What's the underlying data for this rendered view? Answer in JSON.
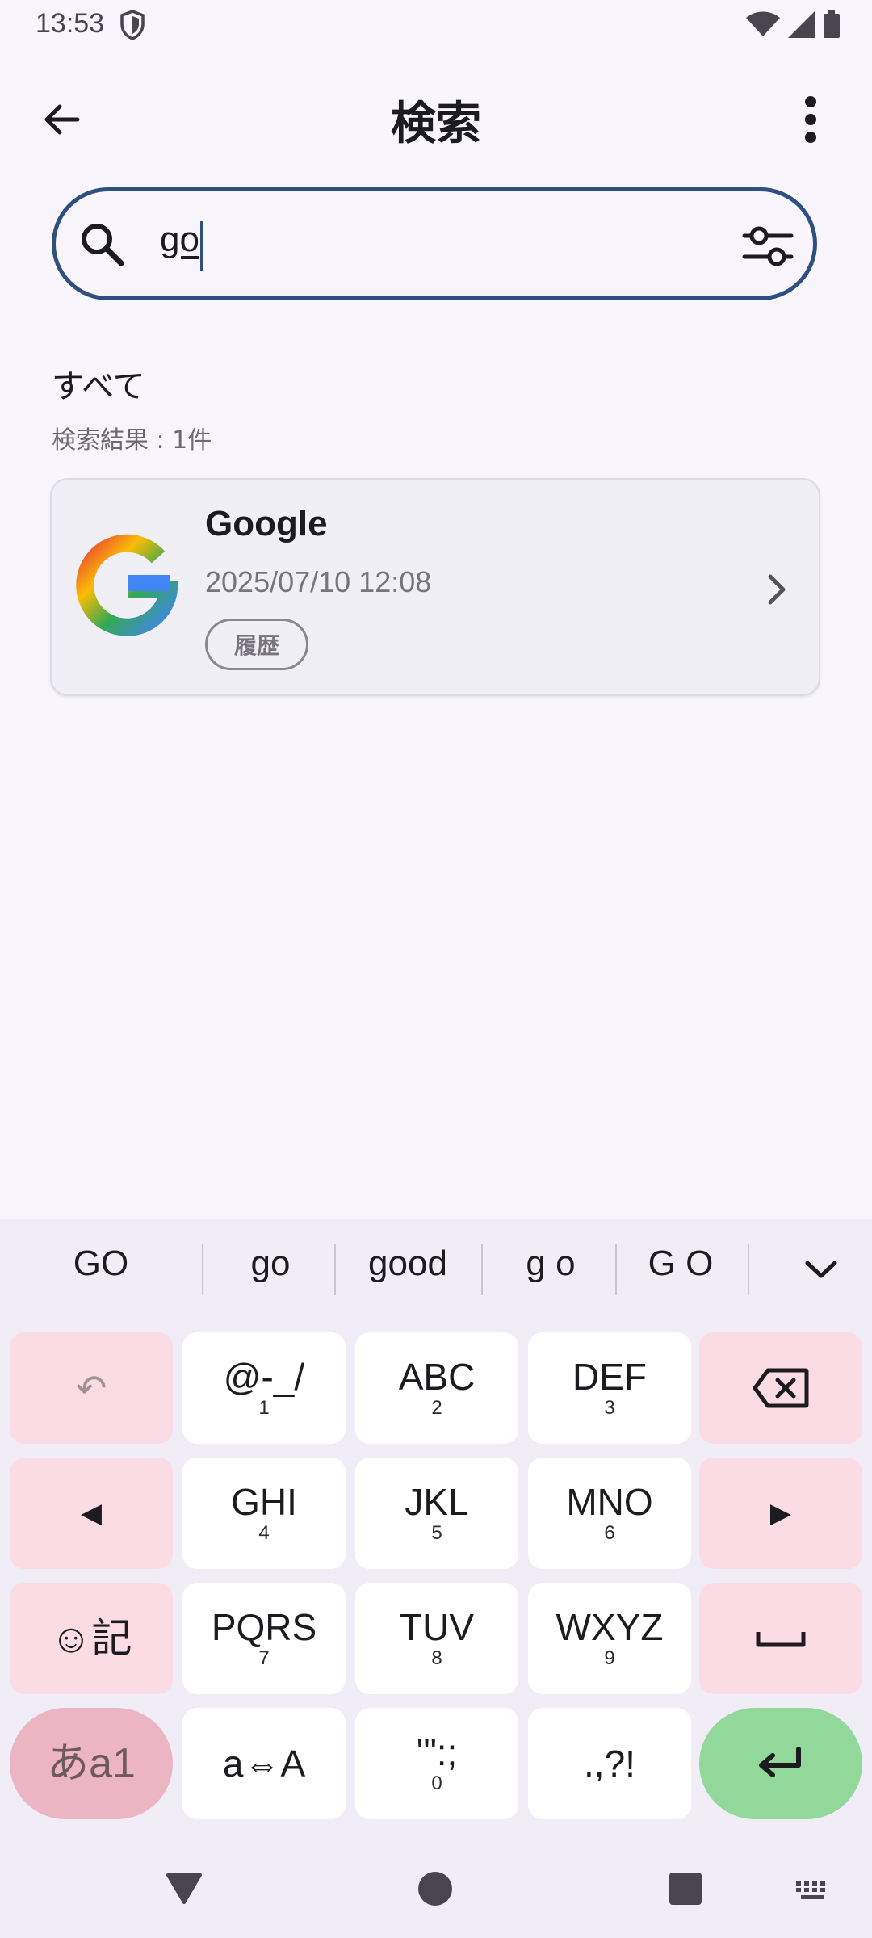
{
  "status_bar": {
    "time": "13:53"
  },
  "app_bar": {
    "title": "検索"
  },
  "search": {
    "value": "go"
  },
  "section": {
    "title": "すべて",
    "result_count": "検索結果 : 1件"
  },
  "results": [
    {
      "title": "Google",
      "datetime": "2025/07/10 12:08",
      "tag": "履歴"
    }
  ],
  "keyboard": {
    "suggestions": [
      "GO",
      "go",
      "good",
      "g o",
      "G O"
    ],
    "rows": [
      [
        {
          "main": "↶",
          "sub": ""
        },
        {
          "main": "@-_/",
          "sub": "1"
        },
        {
          "main": "ABC",
          "sub": "2"
        },
        {
          "main": "DEF",
          "sub": "3"
        },
        {
          "main": "⌫",
          "sub": ""
        }
      ],
      [
        {
          "main": "◀",
          "sub": ""
        },
        {
          "main": "GHI",
          "sub": "4"
        },
        {
          "main": "JKL",
          "sub": "5"
        },
        {
          "main": "MNO",
          "sub": "6"
        },
        {
          "main": "▶",
          "sub": ""
        }
      ],
      [
        {
          "main": "☺記",
          "sub": ""
        },
        {
          "main": "PQRS",
          "sub": "7"
        },
        {
          "main": "TUV",
          "sub": "8"
        },
        {
          "main": "WXYZ",
          "sub": "9"
        },
        {
          "main": "␣",
          "sub": ""
        }
      ],
      [
        {
          "main": "あa1",
          "sub": ""
        },
        {
          "main": "a⇔A",
          "sub": ""
        },
        {
          "main": "'\":;",
          "sub": "0"
        },
        {
          "main": ".,?!",
          "sub": ""
        },
        {
          "main": "↵",
          "sub": ""
        }
      ]
    ]
  },
  "colors": {
    "accent": "#2f4f7f",
    "key_pink": "#fcdce4",
    "enter_green": "#92d89a"
  }
}
